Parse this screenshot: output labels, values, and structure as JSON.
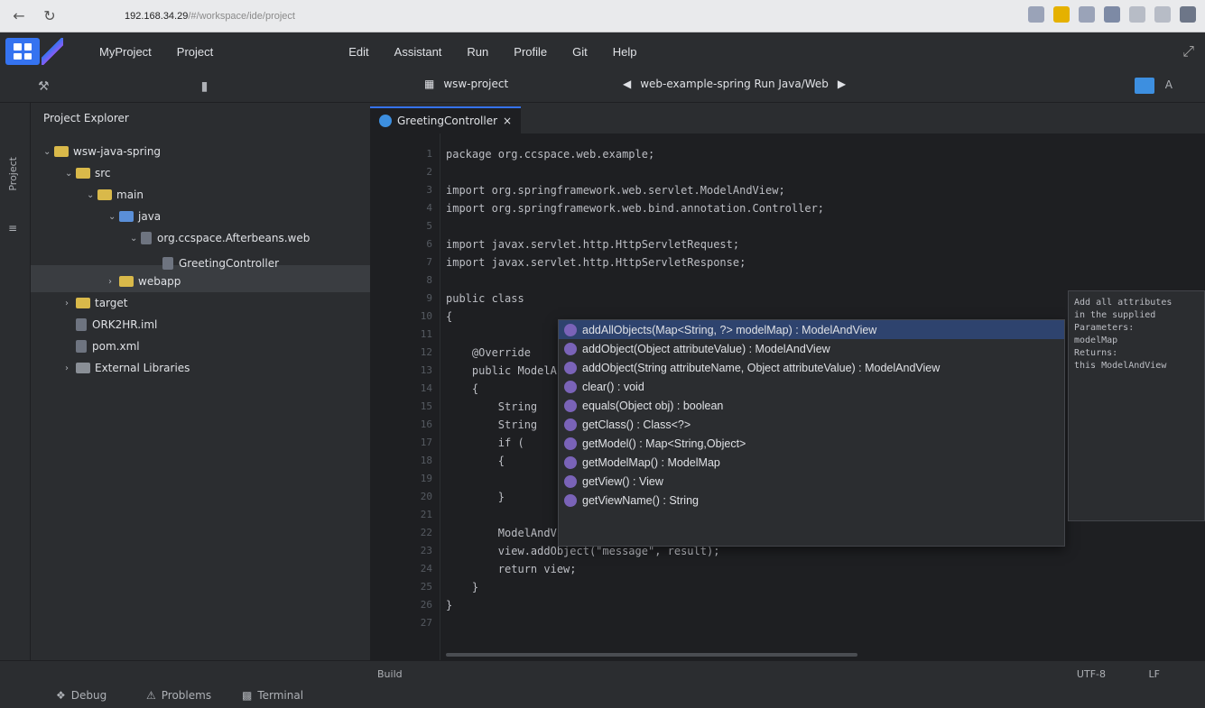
{
  "browser": {
    "address": "192.168.34.29",
    "path": "/#/workspace/ide/project",
    "back_icon": "back-arrow-icon",
    "reload_icon": "reload-icon"
  },
  "menubar": {
    "items": [
      "MyProject",
      "Project",
      "Edit",
      "Assistant",
      "Run",
      "Profile",
      "Git",
      "Help"
    ],
    "expand_icon": "expand-icon"
  },
  "toolbar": {
    "project_label": "wsw-project",
    "run_config_label": "web-example-spring Run Java/Web",
    "run_icon": "play-icon"
  },
  "toolstrip": {
    "label": "Project"
  },
  "project_panel": {
    "title": "Project Explorer",
    "tree": [
      {
        "label": "wsw-java-spring",
        "level": 0,
        "icon": "folder",
        "arrow": "v"
      },
      {
        "label": "src",
        "level": 1,
        "icon": "folder",
        "arrow": "v"
      },
      {
        "label": "main",
        "level": 2,
        "icon": "folder",
        "arrow": "v"
      },
      {
        "label": "java",
        "level": 3,
        "icon": "folder-blue",
        "arrow": "v"
      },
      {
        "label": "org.ccspace.Afterbeans.web",
        "level": 4,
        "icon": "package",
        "arrow": "v"
      },
      {
        "label": "GreetingController",
        "level": 5,
        "icon": "class",
        "arrow": ""
      },
      {
        "label": "webapp",
        "level": 3,
        "icon": "folder",
        "arrow": ">"
      },
      {
        "label": "target",
        "level": 1,
        "icon": "folder",
        "arrow": ">"
      },
      {
        "label": "ORK2HR.iml",
        "level": 1,
        "icon": "file",
        "arrow": ""
      },
      {
        "label": "pom.xml",
        "level": 1,
        "icon": "file",
        "arrow": ""
      },
      {
        "label": "External Libraries",
        "level": 1,
        "icon": "jar",
        "arrow": ">"
      }
    ]
  },
  "editor": {
    "tab_label": "GreetingController",
    "line_numbers": [
      "1",
      "2",
      "3",
      "4",
      "5",
      "6",
      "7",
      "8",
      "9",
      "10",
      "11",
      "12",
      "13",
      "14",
      "15",
      "16",
      "17",
      "18",
      "19",
      "20",
      "21",
      "22",
      "23",
      "24",
      "25",
      "26",
      "27"
    ],
    "code_lines": [
      "package org.ccspace.web.example;",
      "",
      "import org.springframework.web.servlet.ModelAndView;",
      "import org.springframework.web.bind.annotation.Controller;",
      "",
      "import javax.servlet.http.HttpServletRequest;",
      "import javax.servlet.http.HttpServletResponse;",
      "",
      "public class",
      "{",
      "",
      "    @Override",
      "    public ModelAndView",
      "    {",
      "        String",
      "        String",
      "        if (",
      "        {",
      "",
      "        }",
      "",
      "        ModelAndView",
      "        view.addObject(\"message\", result);",
      "        return view;",
      "    }",
      "}"
    ]
  },
  "completion": {
    "items": [
      "addAllObjects(Map<String, ?> modelMap) : ModelAndView",
      "addObject(Object attributeValue) : ModelAndView",
      "addObject(String attributeName, Object attributeValue) : ModelAndView",
      "clear() : void",
      "equals(Object obj) : boolean",
      "getClass() : Class<?>",
      "getModel() : Map<String,Object>",
      "getModelMap() : ModelMap",
      "getView() : View",
      "getViewName() : String"
    ],
    "selected_index": 0
  },
  "doc_popup": {
    "lines": [
      "Add all attributes",
      "in the supplied",
      "Parameters:",
      "modelMap",
      "Returns:",
      "this ModelAndView"
    ]
  },
  "bottombar": {
    "items": [
      "Debug",
      "Problems",
      "Terminal"
    ],
    "status_left": "Build",
    "status_right_1": "UTF-8",
    "status_right_2": "LF"
  }
}
